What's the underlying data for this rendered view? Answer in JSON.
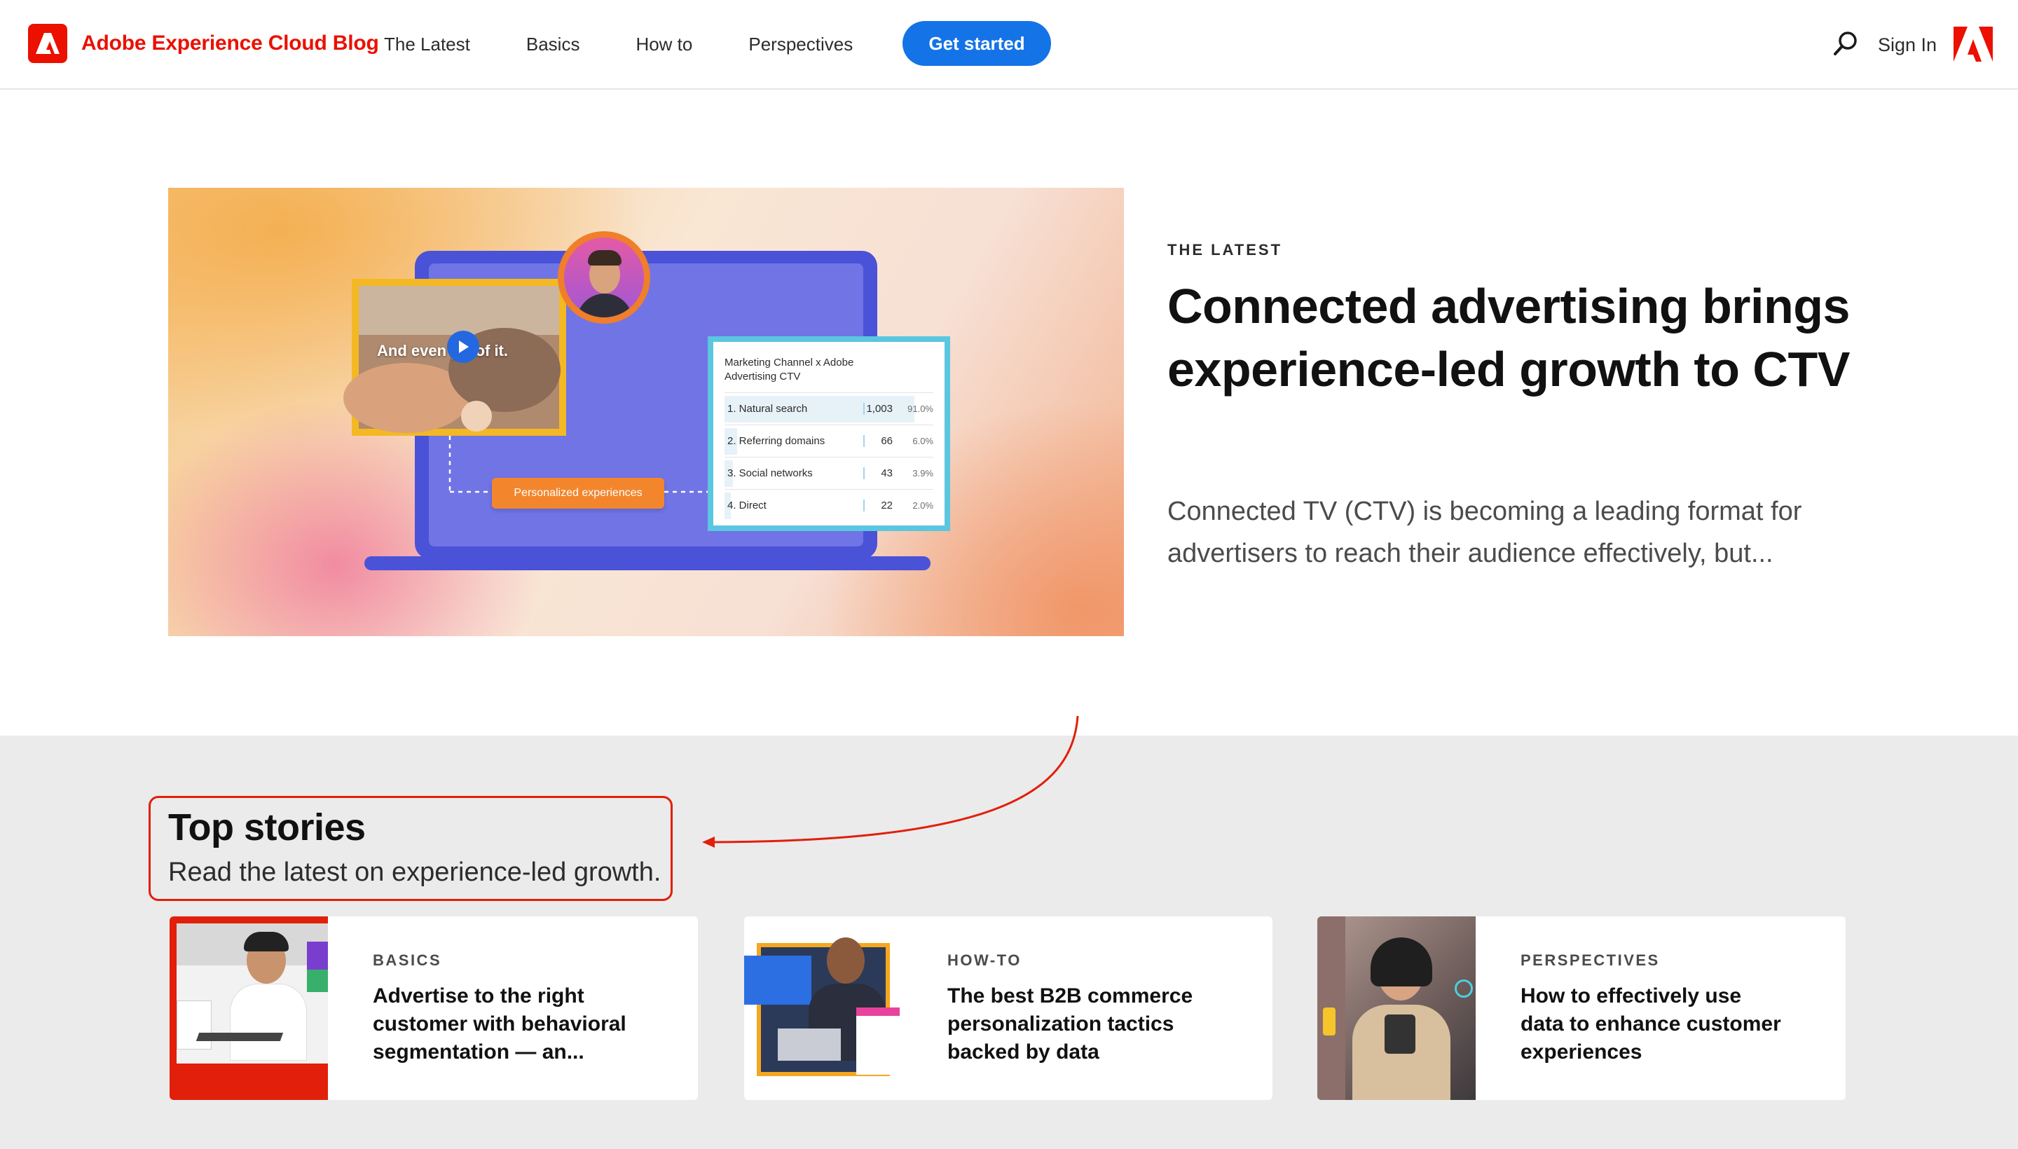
{
  "header": {
    "brand": "Adobe Experience Cloud Blog",
    "nav": [
      "The Latest",
      "Basics",
      "How to",
      "Perspectives"
    ],
    "cta": "Get started",
    "sign_in": "Sign In"
  },
  "hero": {
    "eyebrow": "THE LATEST",
    "title": "Connected advertising brings experience-led growth to CTV",
    "description": "Connected TV (CTV) is becoming a leading format for advertisers to reach their audience effectively, but...",
    "image": {
      "video_caption": "And even proof it.",
      "tag": "Personalized experiences",
      "table_title": "Marketing Channel x Adobe Advertising CTV",
      "rows": [
        {
          "label": "1.  Natural search",
          "value": "1,003",
          "pct": "91.0%",
          "share": 0.91
        },
        {
          "label": "2.  Referring domains",
          "value": "66",
          "pct": "6.0%",
          "share": 0.06
        },
        {
          "label": "3.  Social networks",
          "value": "43",
          "pct": "3.9%",
          "share": 0.039
        },
        {
          "label": "4.  Direct",
          "value": "22",
          "pct": "2.0%",
          "share": 0.02
        }
      ]
    }
  },
  "stories": {
    "title": "Top stories",
    "subtitle": "Read the latest on experience-led growth.",
    "cards": [
      {
        "eyebrow": "BASICS",
        "title": "Advertise to the right customer with behavioral segmentation — an..."
      },
      {
        "eyebrow": "HOW-TO",
        "title": "The best B2B commerce personalization tactics backed by data"
      },
      {
        "eyebrow": "PERSPECTIVES",
        "title": "How to effectively use data to enhance customer experiences"
      }
    ]
  },
  "colors": {
    "brand_red": "#eb1000",
    "cta_blue": "#1473e6",
    "annotation_red": "#e11f0b",
    "section_grey": "#ebebeb"
  },
  "icons": [
    "adobe-logo-icon",
    "search-icon",
    "adobe-mark-icon",
    "play-icon"
  ]
}
